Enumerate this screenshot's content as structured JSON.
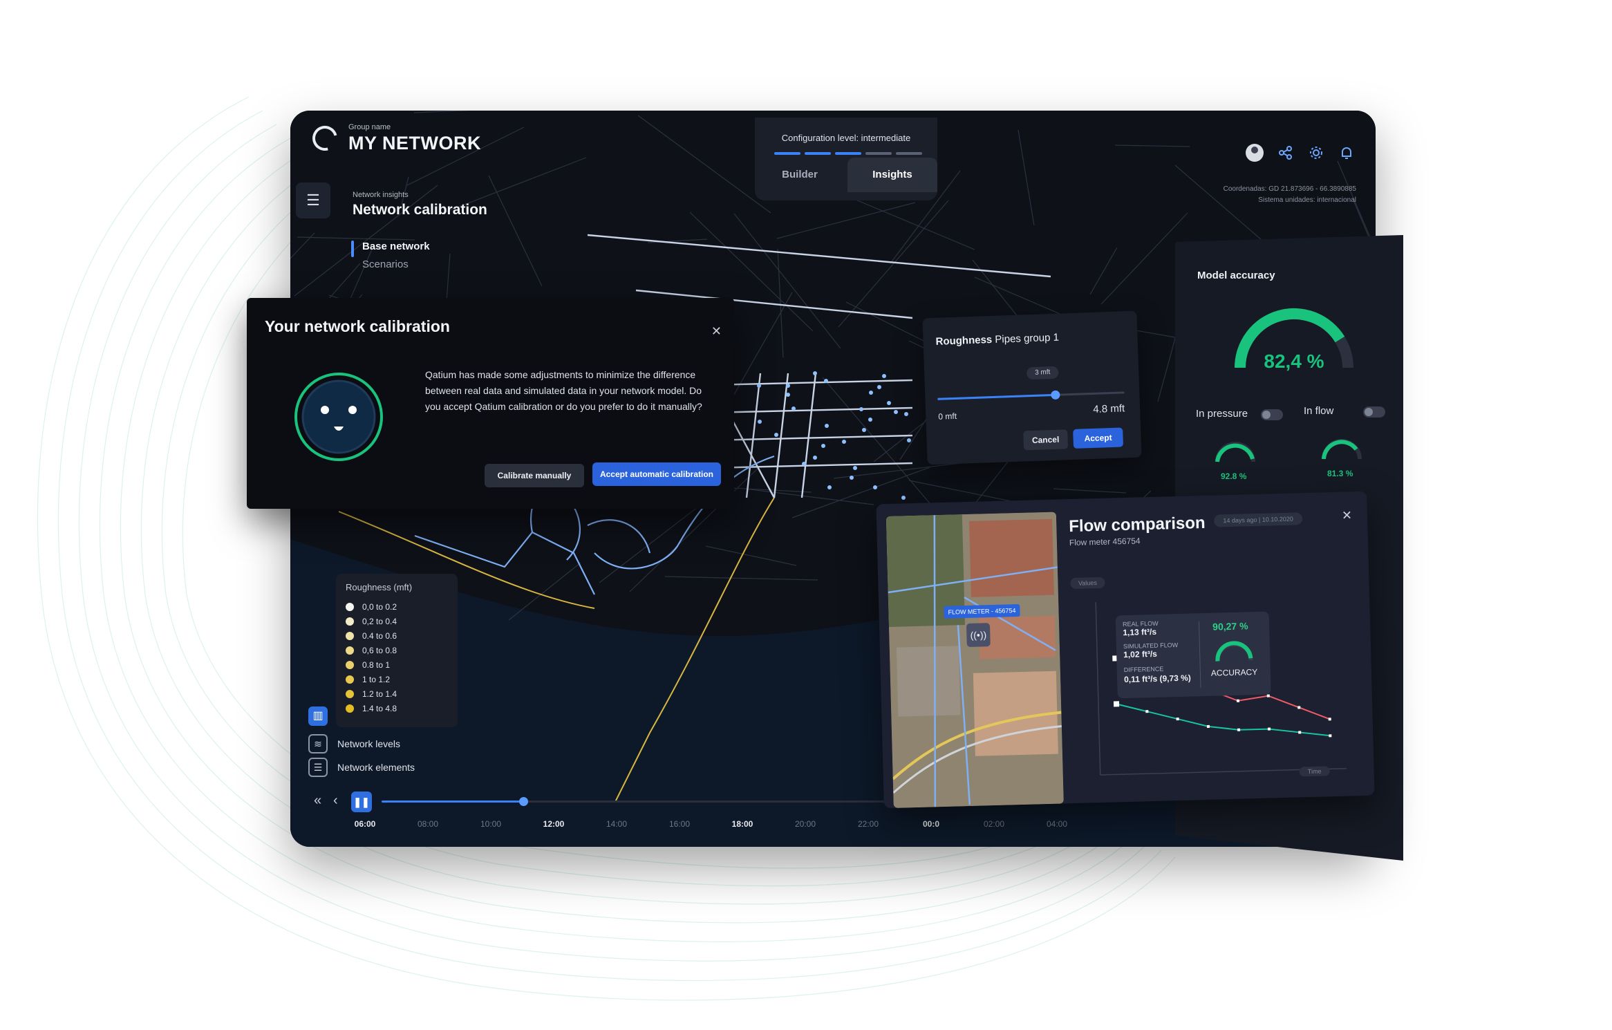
{
  "app": {
    "group_label": "Group name",
    "title": "MY NETWORK"
  },
  "config": {
    "label": "Configuration level: intermediate",
    "bar_colors": [
      "#3b82f6",
      "#3b82f6",
      "#3b82f6",
      "#5a6172",
      "#5a6172"
    ]
  },
  "tabs": [
    {
      "label": "Builder",
      "active": false
    },
    {
      "label": "Insights",
      "active": true
    }
  ],
  "top_icons": [
    "user-avatar",
    "share-icon",
    "gear-icon",
    "bell-icon"
  ],
  "coords": {
    "line1": "Coordenadas: GD 21.873696 - 66.3890885",
    "line2": "Sistema unidades: internacional"
  },
  "sidebar": {
    "section_sub": "Network insights",
    "section_title": "Network calibration",
    "items": [
      {
        "label": "Base network",
        "active": true
      },
      {
        "label": "Scenarios",
        "active": false
      }
    ]
  },
  "legend": {
    "title": "Roughness (mft)",
    "items": [
      {
        "label": "0,0 to 0.2",
        "color": "#f4f4f2"
      },
      {
        "label": "0,2 to 0.4",
        "color": "#f3ecc9"
      },
      {
        "label": "0.4 to 0.6",
        "color": "#efe3a9"
      },
      {
        "label": "0,6 to 0.8",
        "color": "#ecd98a"
      },
      {
        "label": "0.8 to 1",
        "color": "#ead06c"
      },
      {
        "label": "1 to 1.2",
        "color": "#e8c94f"
      },
      {
        "label": "1.2 to 1.4",
        "color": "#e6c43a"
      },
      {
        "label": "1.4 to 4.8",
        "color": "#e4be22"
      }
    ]
  },
  "tools": {
    "network_levels": "Network levels",
    "network_elements": "Network elements"
  },
  "timeline": {
    "progress": 0.25,
    "ticks": [
      {
        "label": "06:00",
        "major": true
      },
      {
        "label": "08:00",
        "major": false
      },
      {
        "label": "10:00",
        "major": false
      },
      {
        "label": "12:00",
        "major": true
      },
      {
        "label": "14:00",
        "major": false
      },
      {
        "label": "16:00",
        "major": false
      },
      {
        "label": "18:00",
        "major": true
      },
      {
        "label": "20:00",
        "major": false
      },
      {
        "label": "22:00",
        "major": false
      },
      {
        "label": "00:0",
        "major": true
      },
      {
        "label": "02:00",
        "major": false
      },
      {
        "label": "04:00",
        "major": false
      }
    ]
  },
  "calibration": {
    "title": "Your network calibration",
    "message": "Qatium has made some adjustments to minimize the difference between real data and simulated data in your network model. Do you accept Qatium calibration or do you prefer to do it manually?",
    "calibrate_manually": "Calibrate manually",
    "accept_automatic": "Accept automatic calibration"
  },
  "roughness": {
    "title_bold": "Roughness",
    "title_rest": "Pipes group 1",
    "pill": "3 mft",
    "value_fraction": 0.63,
    "min_label": "0 mft",
    "max_label": "4.8 mft",
    "cancel": "Cancel",
    "accept": "Accept"
  },
  "accuracy": {
    "title": "Model accuracy",
    "overall": "82,4 %",
    "overall_value": 82.4,
    "in_pressure_label": "In pressure",
    "in_flow_label": "In flow",
    "pressure_value": "92.8 %",
    "flow_value": "81.3 %",
    "accent": "#19c37d"
  },
  "flow": {
    "title": "Flow comparison",
    "subtitle": "Flow meter 456754",
    "date": "14 days ago | 10.10.2020",
    "pill": "Values",
    "map_badge": "FLOW METER - 456754",
    "real_flow_label": "REAL FLOW",
    "real_flow_value": "1,13 ft³/s",
    "sim_flow_label": "SIMULATED FLOW",
    "sim_flow_value": "1,02 ft³/s",
    "diff_label": "DIFFERENCE",
    "diff_value": "0,11 ft³/s (9,73 %)",
    "accuracy_pct": "90,27 %",
    "accuracy_label": "ACCURACY",
    "x_label": "Time"
  },
  "chart_data": {
    "type": "line",
    "series": [
      {
        "name": "REAL FLOW",
        "values": [
          1.13,
          1.1,
          1.04,
          1.05,
          1.02,
          1.03,
          1.0,
          0.97
        ],
        "color": "#f15b67"
      },
      {
        "name": "SIMULATED FLOW",
        "values": [
          1.02,
          1.0,
          0.98,
          0.96,
          0.95,
          0.95,
          0.94,
          0.93
        ],
        "color": "#19c3a0"
      }
    ],
    "ylim": [
      0.85,
      1.25
    ]
  }
}
